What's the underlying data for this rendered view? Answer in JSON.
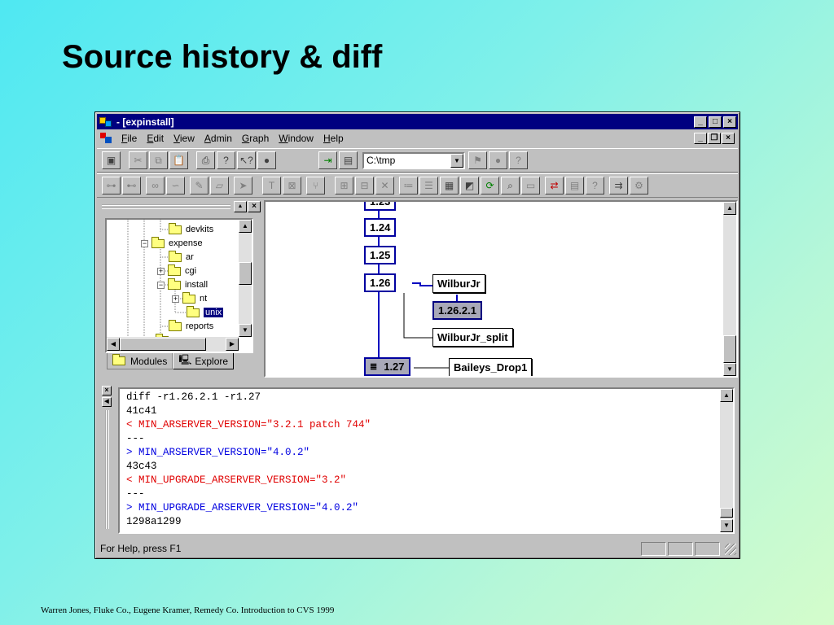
{
  "slide": {
    "title": "Source history & diff",
    "footer": "Warren Jones, Fluke Co., Eugene Kramer, Remedy Co.  Introduction to CVS    1999"
  },
  "window": {
    "title": "- [expinstall]",
    "controls": {
      "minimize": "_",
      "maximize": "□",
      "close": "×"
    },
    "mdi_controls": {
      "minimize": "_",
      "restore": "❐",
      "close": "×"
    }
  },
  "menu": {
    "items": [
      {
        "key": "F",
        "rest": "ile"
      },
      {
        "key": "E",
        "rest": "dit"
      },
      {
        "key": "V",
        "rest": "iew"
      },
      {
        "key": "A",
        "rest": "dmin"
      },
      {
        "key": "G",
        "rest": "raph"
      },
      {
        "key": "W",
        "rest": "indow"
      },
      {
        "key": "H",
        "rest": "elp"
      }
    ]
  },
  "toolbar1": {
    "path_value": "C:\\tmp",
    "icons": [
      "save-icon",
      "cut-icon",
      "copy-icon",
      "paste-icon",
      "print-icon",
      "help-icon",
      "context-help-icon",
      "stop-icon",
      "checkout-icon",
      "module-icon",
      "dropdown-icon",
      "browse-icon",
      "record-icon",
      "question-icon"
    ]
  },
  "toolbar2": {
    "icons": [
      "lock-icon",
      "unlock-icon",
      "edit-icon",
      "unedit-icon",
      "pencil-icon",
      "eraser-icon",
      "fish-icon",
      "tag-icon",
      "untag-icon",
      "branch-icon",
      "add-icon",
      "remove-icon",
      "delete-icon",
      "log-icon",
      "list-icon",
      "grid-icon",
      "graph-icon",
      "refresh-icon",
      "query-icon",
      "diff-icon",
      "merge-icon",
      "annotate-icon",
      "info-icon",
      "export-icon",
      "settings-icon"
    ]
  },
  "tree": {
    "items": [
      {
        "label": "devkits",
        "depth": 2,
        "toggle": "",
        "open": false
      },
      {
        "label": "expense",
        "depth": 1,
        "toggle": "−",
        "open": true
      },
      {
        "label": "ar",
        "depth": 2,
        "toggle": "",
        "open": false
      },
      {
        "label": "cgi",
        "depth": 2,
        "toggle": "+",
        "open": false
      },
      {
        "label": "install",
        "depth": 2,
        "toggle": "−",
        "open": true
      },
      {
        "label": "nt",
        "depth": 3,
        "toggle": "+",
        "open": false
      },
      {
        "label": "unix",
        "depth": 3,
        "toggle": "",
        "open": false,
        "selected": true
      },
      {
        "label": "reports",
        "depth": 2,
        "toggle": "",
        "open": false
      }
    ],
    "tabs": [
      "Modules",
      "Explore"
    ],
    "active_tab": "Explore"
  },
  "graph": {
    "revisions": [
      "1.23",
      "1.24",
      "1.25",
      "1.26",
      "1.27"
    ],
    "branches": [
      {
        "label": "WilburJr",
        "from": "1.26"
      },
      {
        "label": "1.26.2.1",
        "from": "WilburJr"
      },
      {
        "label": "WilburJr_split",
        "from": "1.26"
      },
      {
        "label": "Baileys_Drop1",
        "from": "1.27"
      }
    ]
  },
  "diff": {
    "lines": [
      {
        "text": "diff -r1.26.2.1 -r1.27",
        "color": "black"
      },
      {
        "text": "41c41",
        "color": "black"
      },
      {
        "text": "< MIN_ARSERVER_VERSION=\"3.2.1 patch 744\"",
        "color": "red"
      },
      {
        "text": "---",
        "color": "black"
      },
      {
        "text": "> MIN_ARSERVER_VERSION=\"4.0.2\"",
        "color": "blue"
      },
      {
        "text": "43c43",
        "color": "black"
      },
      {
        "text": "< MIN_UPGRADE_ARSERVER_VERSION=\"3.2\"",
        "color": "red"
      },
      {
        "text": "---",
        "color": "black"
      },
      {
        "text": "> MIN_UPGRADE_ARSERVER_VERSION=\"4.0.2\"",
        "color": "blue"
      },
      {
        "text": "1298a1299",
        "color": "black"
      }
    ]
  },
  "status": {
    "text": "For Help, press F1"
  },
  "colors": {
    "titlebar": "#000080",
    "removed": "#e00000",
    "added": "#0000e0",
    "chrome": "#c0c0c0"
  }
}
